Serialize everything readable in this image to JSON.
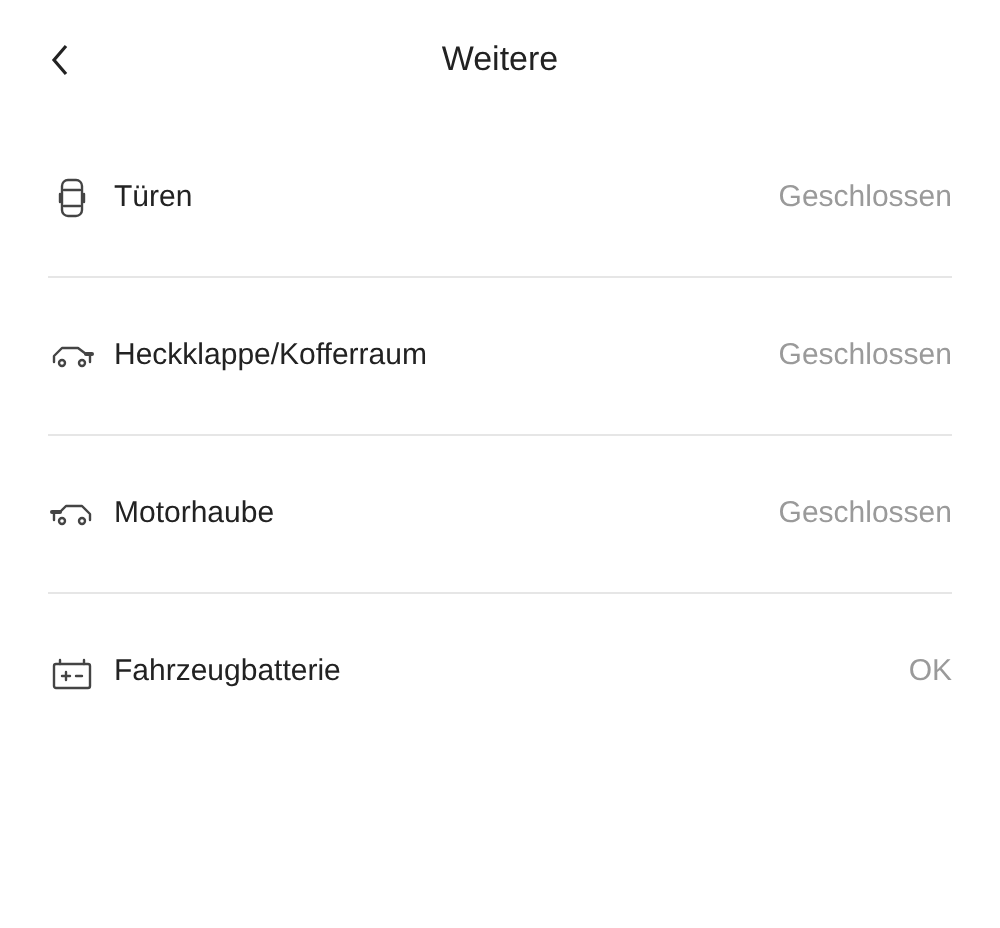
{
  "header": {
    "title": "Weitere"
  },
  "items": [
    {
      "kind": "doors",
      "label": "Türen",
      "status": "Geschlossen"
    },
    {
      "kind": "trunk",
      "label": "Heckklappe/Kofferraum",
      "status": "Geschlossen"
    },
    {
      "kind": "hood",
      "label": "Motorhaube",
      "status": "Geschlossen"
    },
    {
      "kind": "battery",
      "label": "Fahrzeugbatterie",
      "status": "OK"
    }
  ]
}
